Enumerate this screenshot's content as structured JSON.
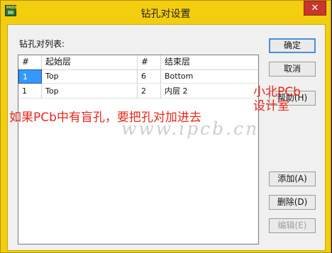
{
  "window": {
    "title": "钻孔对设置",
    "app_icon_label": "PADS",
    "close_glyph": "✕"
  },
  "list": {
    "label": "钻孔对列表:",
    "headers": [
      "#",
      "起始层",
      "#",
      "结束层"
    ],
    "rows": [
      [
        "1",
        "Top",
        "6",
        "Bottom"
      ],
      [
        "1",
        "Top",
        "2",
        "内层 2"
      ]
    ]
  },
  "buttons": {
    "ok": "确定",
    "cancel": "取消",
    "help": "帮助(H)",
    "add": "添加(A)",
    "delete": "删除(D)",
    "edit": "编辑(E)"
  },
  "overlay": {
    "brand_line1": "小北PCb",
    "brand_line2": "设计室",
    "note": "如果PCb中有盲孔，要把孔对加进去",
    "url": "www.ipcb.cn"
  },
  "colors": {
    "window_frame": "#f3ce0f",
    "selection": "#3399ff",
    "close_button": "#c7372d",
    "watermark_red": "#e8271b"
  }
}
